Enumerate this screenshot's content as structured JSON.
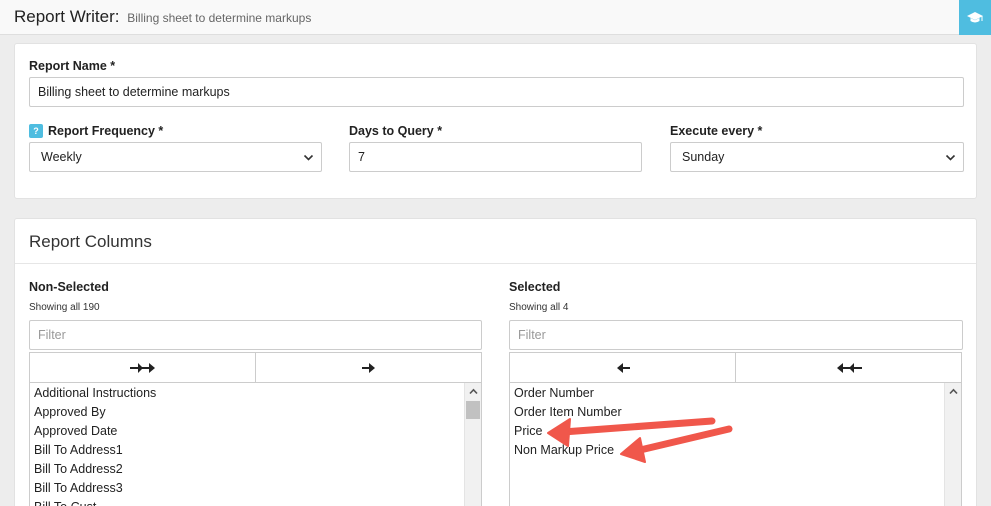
{
  "header": {
    "title": "Report Writer:",
    "subtitle": "Billing sheet to determine markups"
  },
  "settings": {
    "report_name_label": "Report Name *",
    "report_name_value": "Billing sheet to determine markups",
    "help_badge": "?",
    "frequency_label": "Report Frequency *",
    "frequency_value": "Weekly",
    "days_label": "Days to Query *",
    "days_value": "7",
    "execute_label": "Execute every *",
    "execute_value": "Sunday"
  },
  "columns": {
    "title": "Report Columns",
    "non_selected": {
      "label": "Non-Selected",
      "count": "Showing all 190",
      "filter_placeholder": "Filter",
      "items": [
        "Additional Instructions",
        "Approved By",
        "Approved Date",
        "Bill To Address1",
        "Bill To Address2",
        "Bill To Address3",
        "Bill To Cust..."
      ]
    },
    "selected": {
      "label": "Selected",
      "count": "Showing all 4",
      "filter_placeholder": "Filter",
      "items": [
        "Order Number",
        "Order Item Number",
        "Price",
        "Non Markup Price"
      ]
    }
  },
  "colors": {
    "accent": "#4fbde0",
    "annotation_arrow": "#f0574b"
  },
  "icons": {
    "help": "graduation-cap-icon",
    "move_all_right": "double-arrow-right-icon",
    "move_right": "arrow-right-icon",
    "move_left": "arrow-left-icon",
    "move_all_left": "double-arrow-left-icon"
  }
}
